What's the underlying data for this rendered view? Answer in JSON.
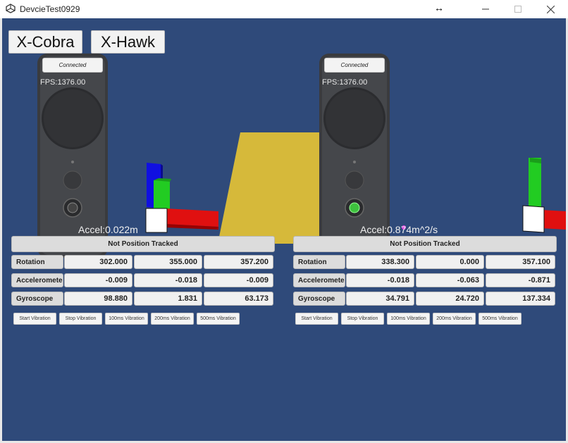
{
  "window": {
    "title": "DevcieTest0929",
    "resize_glyph": "↔",
    "controls": [
      "minimize-icon",
      "maximize-icon",
      "close-icon"
    ]
  },
  "tabs": [
    {
      "label": "X-Cobra"
    },
    {
      "label": "X-Hawk"
    }
  ],
  "panels": [
    {
      "connection": "Connected",
      "fps": "FPS:1376.00",
      "accel": "Accel:0.022m",
      "tracking": "Not Position Tracked",
      "rows": [
        {
          "label": "Rotation",
          "values": [
            "302.000",
            "355.000",
            "357.200"
          ]
        },
        {
          "label": "Acceleromete",
          "values": [
            "-0.009",
            "-0.018",
            "-0.009"
          ]
        },
        {
          "label": "Gyroscope",
          "values": [
            "98.880",
            "1.831",
            "63.173"
          ]
        }
      ],
      "buttons": [
        "Start Vibration",
        "Stop Vibration",
        "100ms Vibration",
        "200ms Vibration",
        "500ms Vibration"
      ],
      "trigger_color": "#444444"
    },
    {
      "connection": "Connected",
      "fps": "FPS:1376.00",
      "accel": "Accel:0.874m^2/s",
      "tracking": "Not Position Tracked",
      "rows": [
        {
          "label": "Rotation",
          "values": [
            "338.300",
            "0.000",
            "357.100"
          ]
        },
        {
          "label": "Acceleromete",
          "values": [
            "-0.018",
            "-0.063",
            "-0.871"
          ]
        },
        {
          "label": "Gyroscope",
          "values": [
            "34.791",
            "24.720",
            "137.334"
          ]
        }
      ],
      "buttons": [
        "Start Vibration",
        "Stop Vibration",
        "100ms Vibration",
        "200ms Vibration",
        "500ms Vibration"
      ],
      "trigger_color": "#3ec23e"
    }
  ],
  "colors": {
    "background": "#2f4a7a",
    "plane": "#d6b93a",
    "axis_x": "#e01010",
    "axis_y": "#22cc22",
    "axis_z": "#1010e0"
  }
}
